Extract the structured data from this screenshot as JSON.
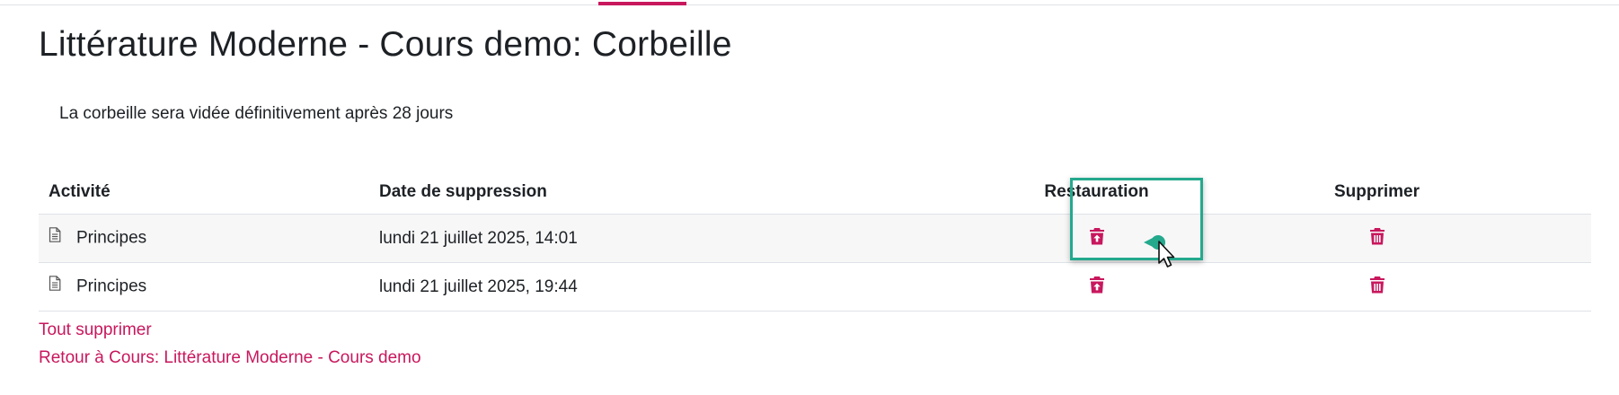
{
  "page": {
    "title": "Littérature Moderne - Cours demo: Corbeille",
    "notice": "La corbeille sera vidée définitivement après 28 jours"
  },
  "table": {
    "headers": {
      "activity": "Activité",
      "date": "Date de suppression",
      "restore": "Restauration",
      "delete": "Supprimer"
    },
    "rows": [
      {
        "activity": "Principes",
        "date": "lundi 21 juillet 2025, 14:01"
      },
      {
        "activity": "Principes",
        "date": "lundi 21 juillet 2025, 19:44"
      }
    ]
  },
  "links": {
    "delete_all": "Tout supprimer",
    "back": "Retour à Cours: Littérature Moderne - Cours demo"
  },
  "icons": {
    "activity": "document-icon",
    "restore": "trash-restore-icon",
    "delete": "trash-icon"
  },
  "colors": {
    "accent": "#c8175d",
    "highlight": "#24a98d",
    "row_highlight_bg": "#f7f7f7"
  }
}
